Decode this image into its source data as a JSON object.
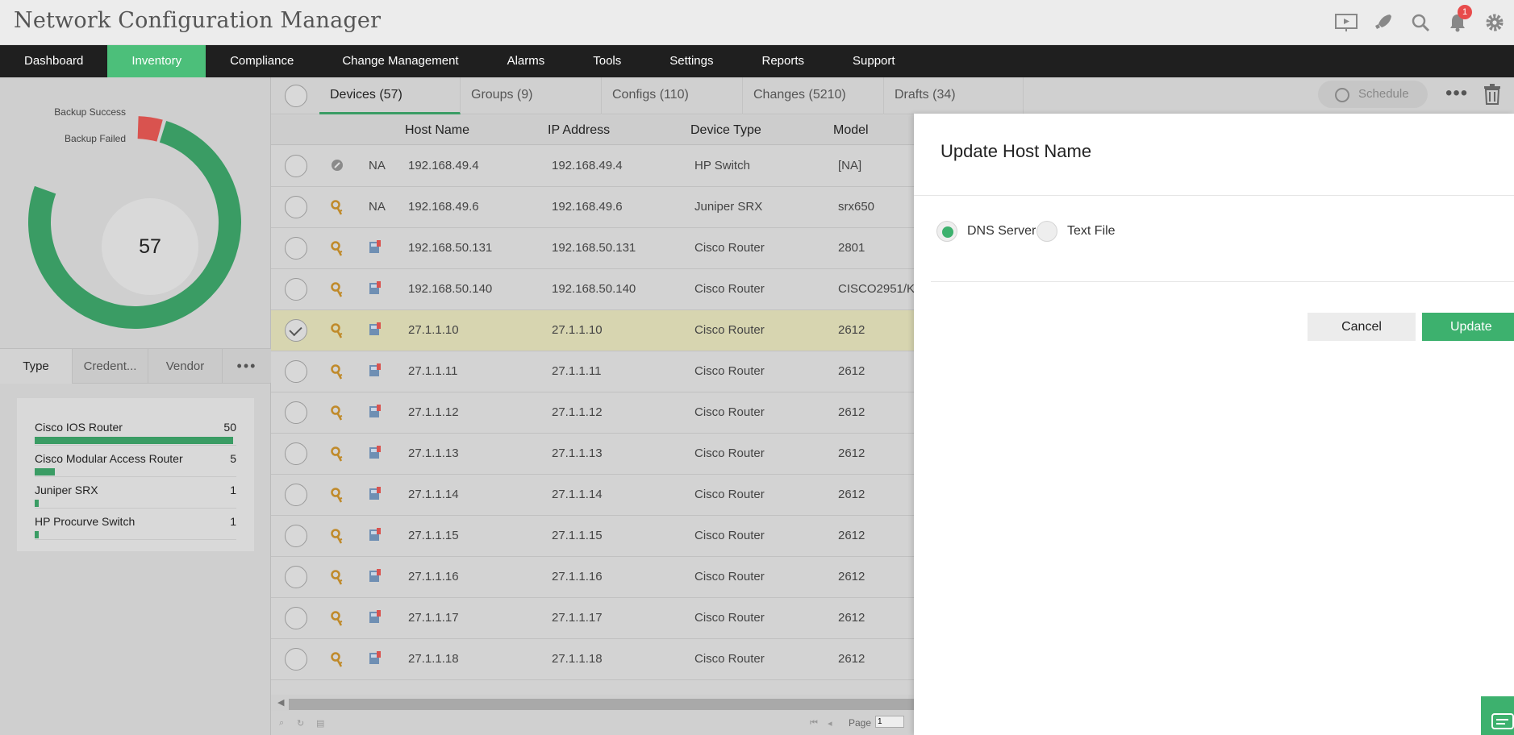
{
  "app": {
    "title": "Network Configuration Manager",
    "notification_count": "1"
  },
  "nav": {
    "items": [
      "Dashboard",
      "Inventory",
      "Compliance",
      "Change Management",
      "Alarms",
      "Tools",
      "Settings",
      "Reports",
      "Support"
    ],
    "active": "Inventory"
  },
  "donut": {
    "total": "57",
    "success_label": "Backup Success",
    "failed_label": "Backup Failed",
    "success_value": 54,
    "failed_value": 3,
    "success_color": "#3a9c64",
    "failed_color": "#d9534f"
  },
  "filter_tabs": {
    "type": "Type",
    "credential": "Credent...",
    "vendor": "Vendor"
  },
  "type_list": [
    {
      "label": "Cisco IOS Router",
      "count": "50",
      "fraction": 1.0
    },
    {
      "label": "Cisco Modular Access Router",
      "count": "5",
      "fraction": 0.1
    },
    {
      "label": "Juniper SRX",
      "count": "1",
      "fraction": 0.02
    },
    {
      "label": "HP Procurve Switch",
      "count": "1",
      "fraction": 0.02
    }
  ],
  "tabs": {
    "devices": "Devices (57)",
    "groups": "Groups (9)",
    "configs": "Configs (110)",
    "changes": "Changes (5210)",
    "drafts": "Drafts (34)",
    "schedule": "Schedule"
  },
  "columns": {
    "host_name": "Host Name",
    "ip_address": "IP Address",
    "device_type": "Device Type",
    "model": "Model"
  },
  "rows": [
    {
      "status": "NA",
      "host": "192.168.49.4",
      "ip": "192.168.49.4",
      "type": "HP Switch",
      "model": "[NA]",
      "icon2": "gray-circle"
    },
    {
      "status": "NA",
      "host": "192.168.49.6",
      "ip": "192.168.49.6",
      "type": "Juniper SRX",
      "model": "srx650",
      "icon2": "key"
    },
    {
      "status": "",
      "host": "192.168.50.131",
      "ip": "192.168.50.131",
      "type": "Cisco Router",
      "model": "2801",
      "icon2": "key"
    },
    {
      "status": "",
      "host": "192.168.50.140",
      "ip": "192.168.50.140",
      "type": "Cisco Router",
      "model": "CISCO2951/K",
      "icon2": "key"
    },
    {
      "status": "",
      "host": "27.1.1.10",
      "ip": "27.1.1.10",
      "type": "Cisco Router",
      "model": "2612",
      "icon2": "key",
      "selected": true
    },
    {
      "status": "",
      "host": "27.1.1.11",
      "ip": "27.1.1.11",
      "type": "Cisco Router",
      "model": "2612",
      "icon2": "key"
    },
    {
      "status": "",
      "host": "27.1.1.12",
      "ip": "27.1.1.12",
      "type": "Cisco Router",
      "model": "2612",
      "icon2": "key"
    },
    {
      "status": "",
      "host": "27.1.1.13",
      "ip": "27.1.1.13",
      "type": "Cisco Router",
      "model": "2612",
      "icon2": "key"
    },
    {
      "status": "",
      "host": "27.1.1.14",
      "ip": "27.1.1.14",
      "type": "Cisco Router",
      "model": "2612",
      "icon2": "key"
    },
    {
      "status": "",
      "host": "27.1.1.15",
      "ip": "27.1.1.15",
      "type": "Cisco Router",
      "model": "2612",
      "icon2": "key"
    },
    {
      "status": "",
      "host": "27.1.1.16",
      "ip": "27.1.1.16",
      "type": "Cisco Router",
      "model": "2612",
      "icon2": "key"
    },
    {
      "status": "",
      "host": "27.1.1.17",
      "ip": "27.1.1.17",
      "type": "Cisco Router",
      "model": "2612",
      "icon2": "key"
    },
    {
      "status": "",
      "host": "27.1.1.18",
      "ip": "27.1.1.18",
      "type": "Cisco Router",
      "model": "2612",
      "icon2": "key"
    }
  ],
  "pager": {
    "page_label": "Page",
    "page_value": "1"
  },
  "dialog": {
    "title": "Update Host Name",
    "option_dns": "DNS Server",
    "option_file": "Text File",
    "selected": "DNS Server",
    "cancel": "Cancel",
    "update": "Update"
  }
}
